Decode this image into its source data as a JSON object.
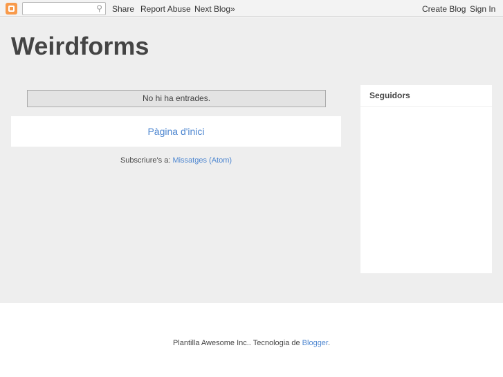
{
  "navbar": {
    "search_placeholder": "",
    "share": "Share",
    "report": "Report Abuse",
    "next": "Next Blog»",
    "create": "Create Blog",
    "signin": "Sign In"
  },
  "blog": {
    "title": "Weirdforms"
  },
  "main": {
    "no_posts": "No hi ha entrades.",
    "home": "Pàgina d'inici",
    "subscribe_label": "Subscriure's a:",
    "subscribe_link": "Missatges (Atom)"
  },
  "sidebar": {
    "followers_title": "Seguidors"
  },
  "footer": {
    "text": "Plantilla Awesome Inc.. Tecnologia de ",
    "link": "Blogger",
    "end": "."
  }
}
